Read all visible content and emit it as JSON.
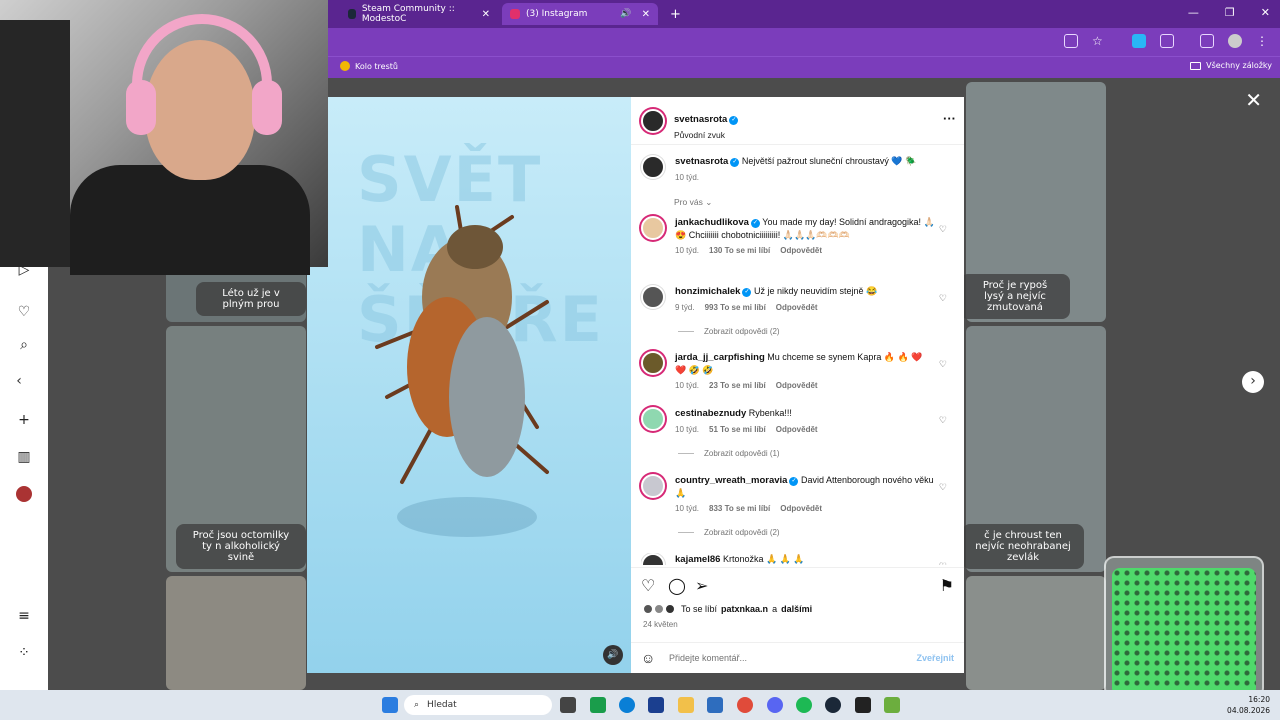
{
  "browser": {
    "tabs": [
      {
        "label": "Steam Community :: ModestoC",
        "active": false
      },
      {
        "label": "(3) Instagram",
        "active": true
      }
    ],
    "new_tab": "+",
    "bookmark_left": "Kolo trestů",
    "bookmark_right": "Všechny záložky"
  },
  "background": {
    "captions": [
      "Léto už je v plným prou",
      "Proč je rypoš lysý a nejvíc zmutovaná",
      "Proč jsou octomilky ty n alkoholický svině",
      "č je chroust ten nejvíc neohrabanej zevlák"
    ]
  },
  "media": {
    "watermark": "SVĚT NA ŠŇŮŘE",
    "mute_icon": "speaker-icon"
  },
  "post": {
    "author": "svetnasrota",
    "audio": "Původní zvuk",
    "caption": "Největší pažrout sluneční chroustavý 💙 🪲",
    "caption_time": "10 týd.",
    "filter": "Pro vás",
    "comments": [
      {
        "user": "jankachudlikova",
        "verified": true,
        "text": "You made my day! Solidní andragogika! 🙏🏻 😍 Chciiiiiii chobotniciiiiiiiii! 🙏🏻🙏🏻🙏🏻🫶🏻🫶🏻🫶🏻",
        "time": "10 týd.",
        "likes": "130 To se mi líbí",
        "reply": "Odpovědět"
      },
      {
        "user": "honzimichalek",
        "verified": true,
        "text": "Už je nikdy neuvidím stejně 😂",
        "time": "9 týd.",
        "likes": "993 To se mi líbí",
        "reply": "Odpovědět",
        "show_replies": "Zobrazit odpovědi (2)"
      },
      {
        "user": "jarda_jj_carpfishing",
        "verified": false,
        "text": "Mu chceme se synem Kapra 🔥 🔥 ❤️ ❤️ 🤣 🤣",
        "time": "10 týd.",
        "likes": "23 To se mi líbí",
        "reply": "Odpovědět"
      },
      {
        "user": "cestinabeznudy",
        "verified": false,
        "text": "Rybenka!!!",
        "time": "10 týd.",
        "likes": "51 To se mi líbí",
        "reply": "Odpovědět",
        "show_replies": "Zobrazit odpovědi (1)"
      },
      {
        "user": "country_wreath_moravia",
        "verified": true,
        "text": "David Attenborough nového věku 🙏",
        "time": "10 týd.",
        "likes": "833 To se mi líbí",
        "reply": "Odpovědět",
        "show_replies": "Zobrazit odpovědi (2)"
      },
      {
        "user": "kajamel86",
        "verified": false,
        "text": "Krtonožka 🙏 🙏 🙏"
      }
    ],
    "liked_by_prefix": "To se líbí",
    "liked_by_user": "patxnkaa.n",
    "liked_by_and": "a",
    "liked_by_others": "dalšími",
    "date": "24 květen",
    "comment_placeholder": "Přidejte komentář...",
    "post_button": "Zveřejnit"
  },
  "taskbar": {
    "search": "Hledat",
    "time": "16:20",
    "date": "04.08.2026"
  },
  "colors": {
    "tabbar": "#5a2590",
    "toolbar": "#7b3dbb",
    "ig_blue": "#0095f6"
  }
}
